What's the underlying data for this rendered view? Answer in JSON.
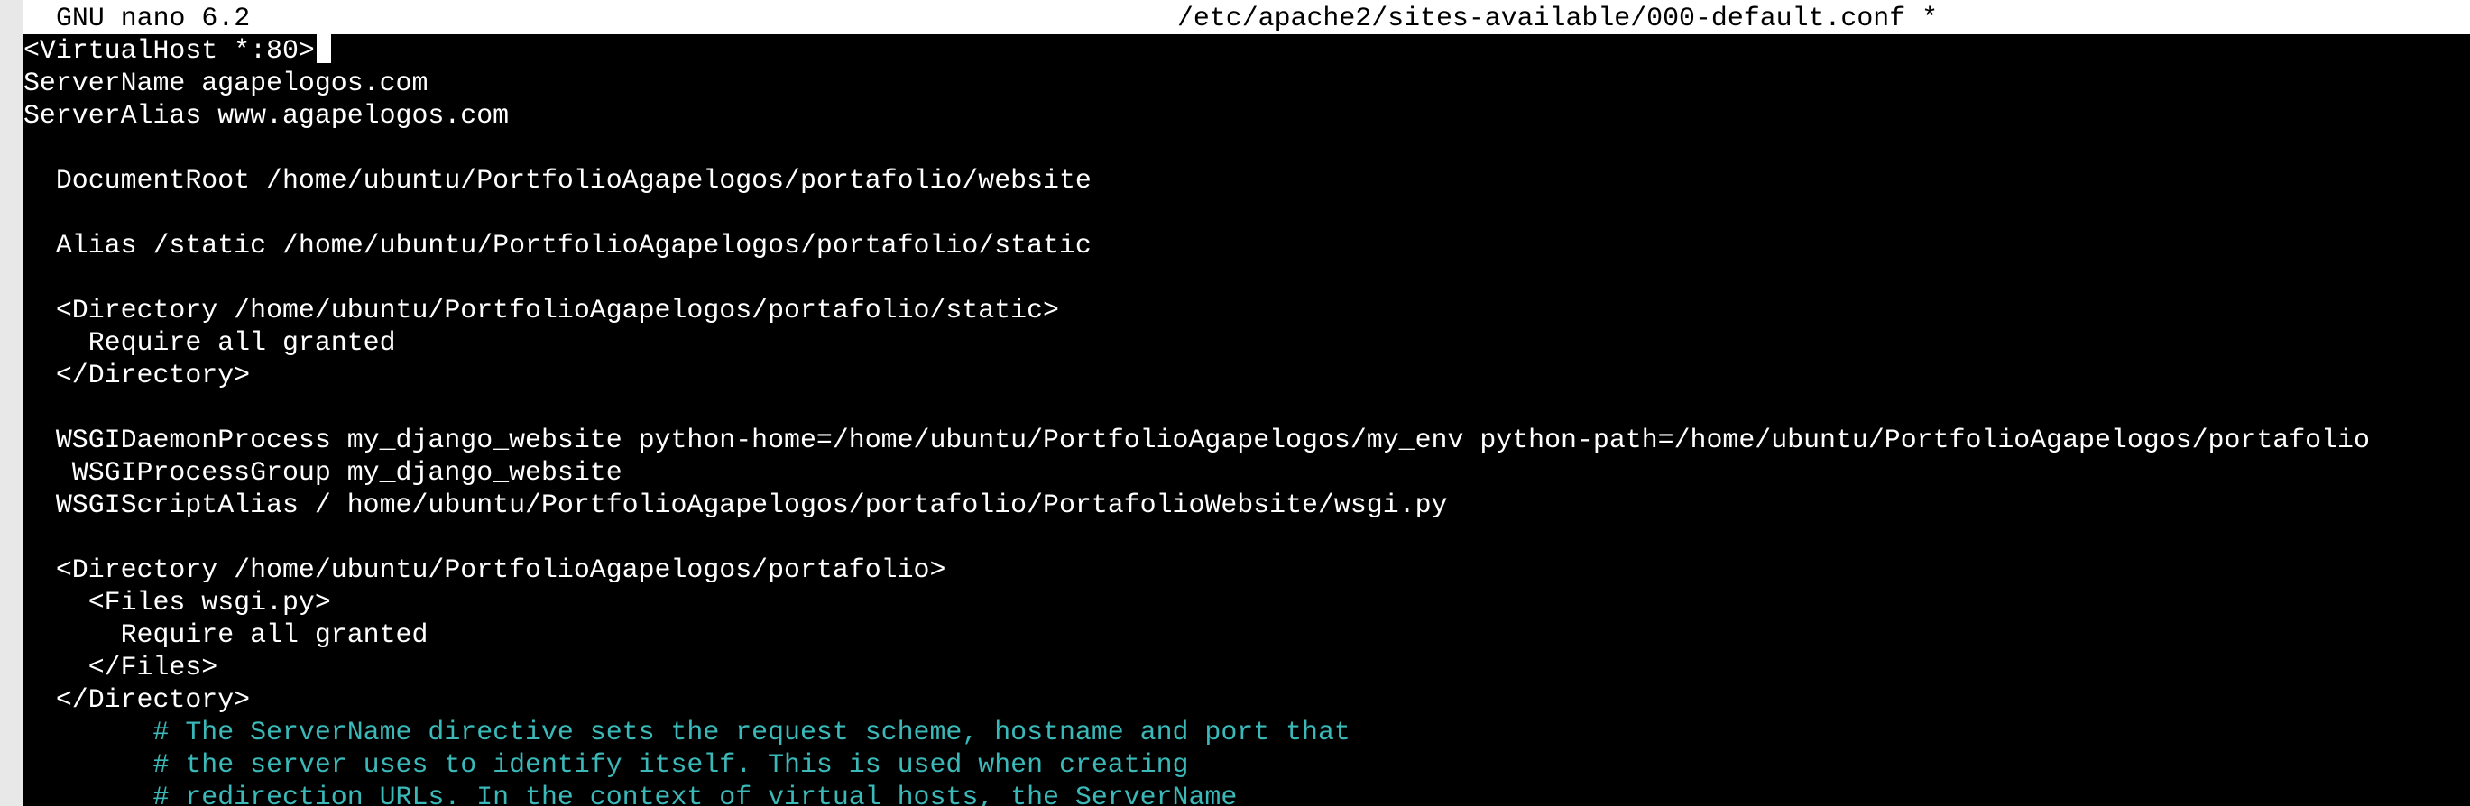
{
  "titlebar": {
    "app_name": "GNU nano 6.2",
    "file_path": "/etc/apache2/sites-available/000-default.conf *"
  },
  "editor": {
    "lines": [
      {
        "text": "<VirtualHost *:80>",
        "type": "code"
      },
      {
        "text": "ServerName agapelogos.com",
        "type": "code"
      },
      {
        "text": "ServerAlias www.agapelogos.com",
        "type": "code"
      },
      {
        "text": "",
        "type": "blank"
      },
      {
        "text": "  DocumentRoot /home/ubuntu/PortfolioAgapelogos/portafolio/website",
        "type": "code"
      },
      {
        "text": "",
        "type": "blank"
      },
      {
        "text": "  Alias /static /home/ubuntu/PortfolioAgapelogos/portafolio/static",
        "type": "code"
      },
      {
        "text": "",
        "type": "blank"
      },
      {
        "text": "  <Directory /home/ubuntu/PortfolioAgapelogos/portafolio/static>",
        "type": "code"
      },
      {
        "text": "    Require all granted",
        "type": "code"
      },
      {
        "text": "  </Directory>",
        "type": "code"
      },
      {
        "text": "",
        "type": "blank"
      },
      {
        "text": "  WSGIDaemonProcess my_django_website python-home=/home/ubuntu/PortfolioAgapelogos/my_env python-path=/home/ubuntu/PortfolioAgapelogos/portafolio",
        "type": "code"
      },
      {
        "text": "   WSGIProcessGroup my_django_website",
        "type": "code"
      },
      {
        "text": "  WSGIScriptAlias / home/ubuntu/PortfolioAgapelogos/portafolio/PortafolioWebsite/wsgi.py",
        "type": "code"
      },
      {
        "text": "",
        "type": "blank"
      },
      {
        "text": "  <Directory /home/ubuntu/PortfolioAgapelogos/portafolio>",
        "type": "code"
      },
      {
        "text": "    <Files wsgi.py>",
        "type": "code"
      },
      {
        "text": "      Require all granted",
        "type": "code"
      },
      {
        "text": "    </Files>",
        "type": "code"
      },
      {
        "text": "  </Directory>",
        "type": "code"
      },
      {
        "text": "        # The ServerName directive sets the request scheme, hostname and port that",
        "type": "comment"
      },
      {
        "text": "        # the server uses to identify itself. This is used when creating",
        "type": "comment"
      },
      {
        "text": "        # redirection URLs. In the context of virtual hosts, the ServerName",
        "type": "comment"
      }
    ]
  },
  "colors": {
    "background": "#000000",
    "text": "#ffffff",
    "titlebar_bg": "#ffffff",
    "comment": "#3bb8b8"
  }
}
